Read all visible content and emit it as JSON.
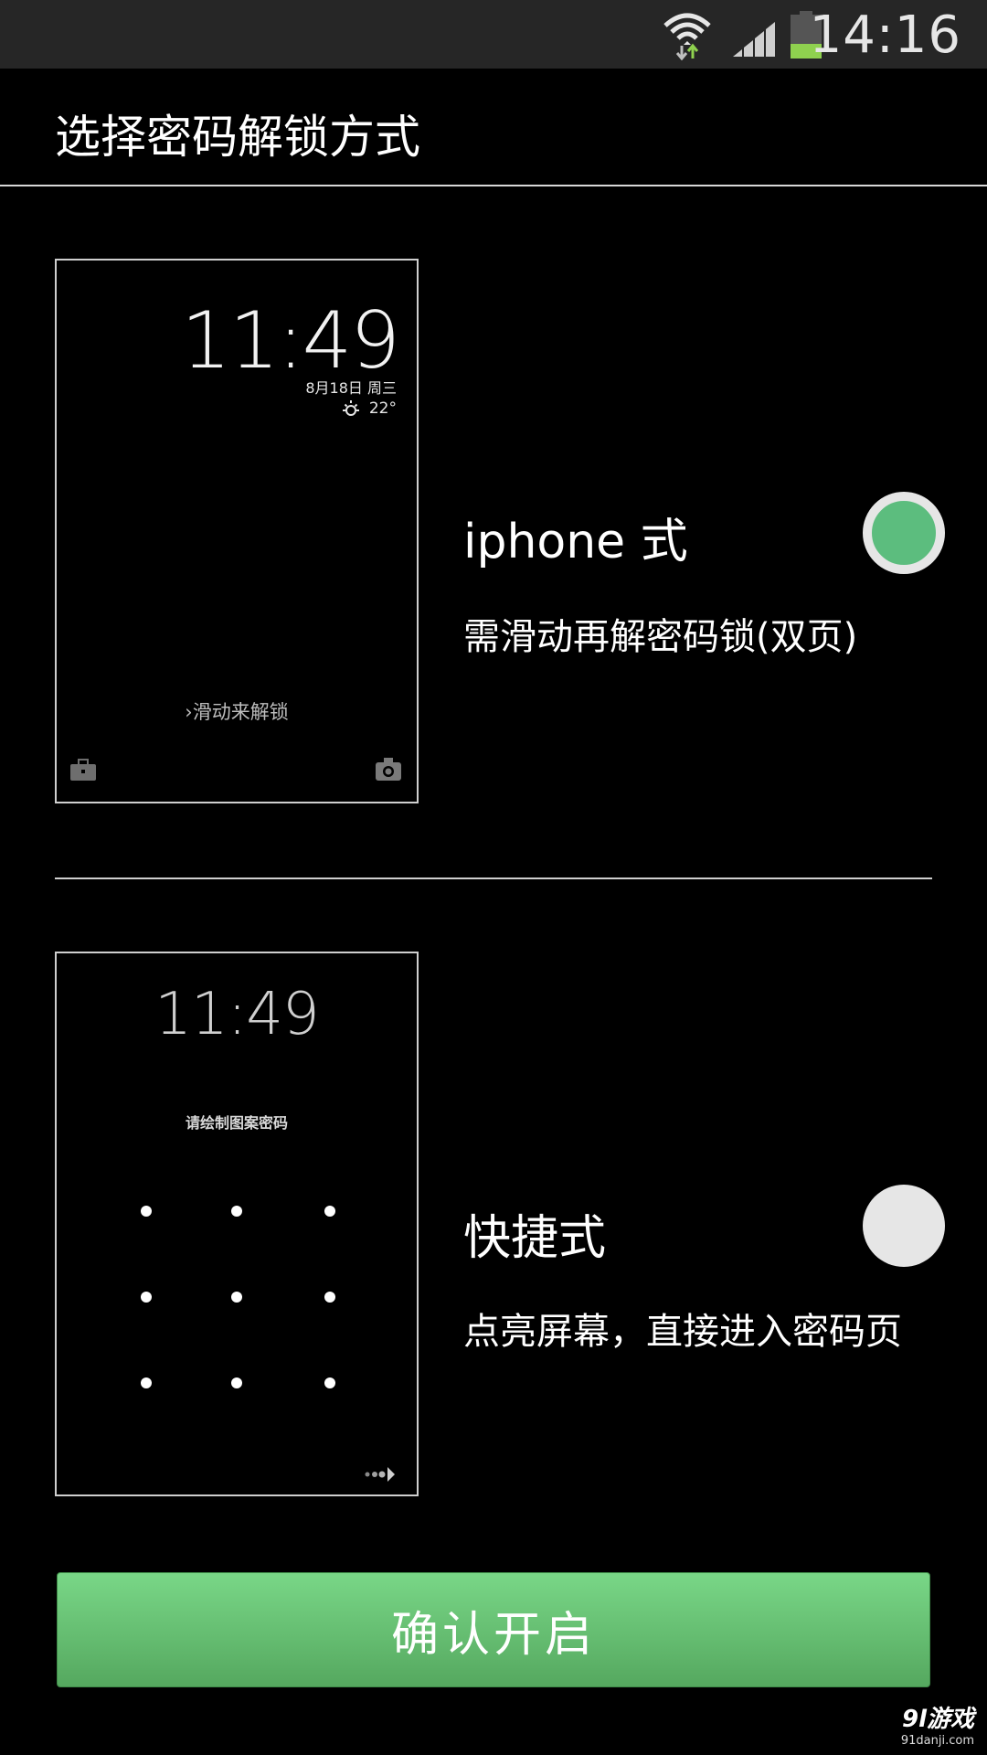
{
  "status_bar": {
    "time": "14:16",
    "icons": [
      "wifi-icon",
      "signal-icon",
      "battery-icon"
    ]
  },
  "header": {
    "title": "选择密码解锁方式"
  },
  "options": [
    {
      "title": "iphone 式",
      "description": "需滑动再解密码锁(双页)",
      "selected": true,
      "preview": {
        "clock": "11:49",
        "date": "8月18日 周三",
        "temperature": "22°",
        "slide_text": "›滑动来解锁"
      }
    },
    {
      "title": "快捷式",
      "description": "点亮屏幕，直接进入密码页",
      "selected": false,
      "preview": {
        "clock": "11:49",
        "hint": "请绘制图案密码"
      }
    }
  ],
  "confirm_button": {
    "label": "确认开启"
  },
  "watermark": {
    "logo": "9l游戏",
    "url": "91danji.com"
  },
  "colors": {
    "accent": "#5cbd7e",
    "button": "#6cc77a",
    "background": "#000000"
  }
}
